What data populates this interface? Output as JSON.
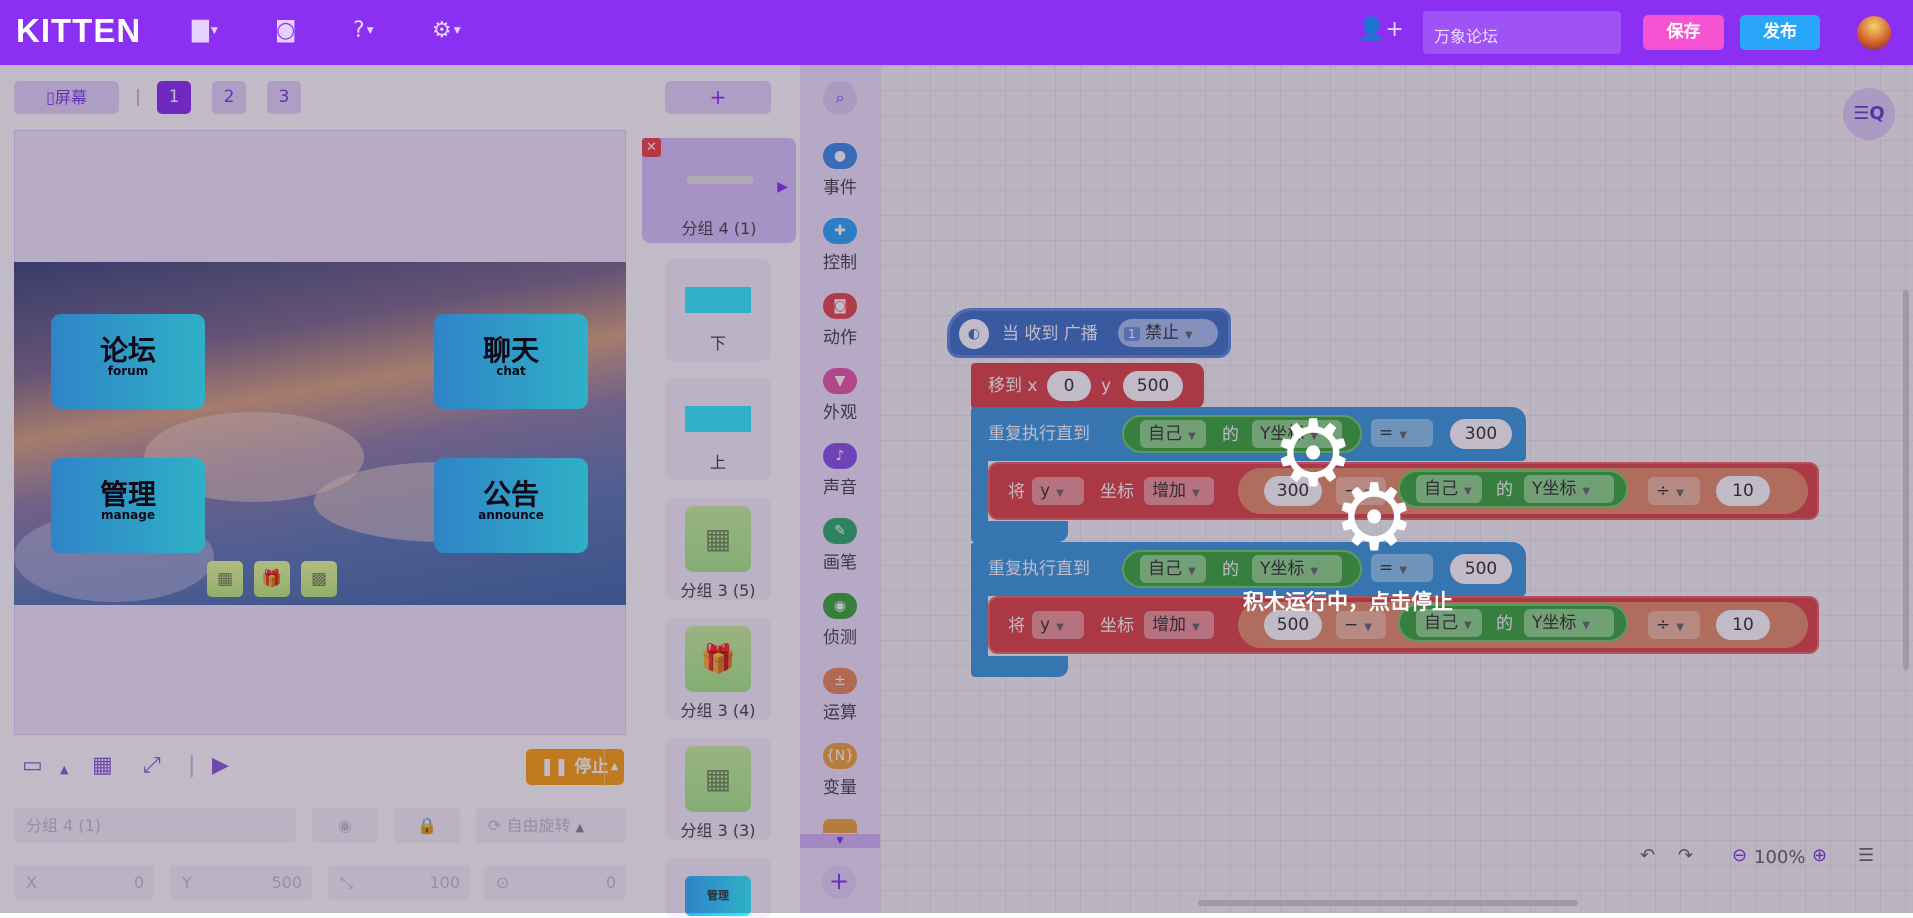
{
  "app": {
    "logo": "KITTEN",
    "search_placeholder": "万象论坛",
    "save_label": "保存",
    "publish_label": "发布"
  },
  "stage_panel": {
    "screen_label": "▯屏幕",
    "pages": [
      "1",
      "2",
      "3"
    ],
    "active_page": "1",
    "tiles": [
      {
        "cn": "论坛",
        "en": "forum"
      },
      {
        "cn": "聊天",
        "en": "chat"
      },
      {
        "cn": "管理",
        "en": "manage"
      },
      {
        "cn": "公告",
        "en": "announce"
      }
    ],
    "stop_label": "停止",
    "props": {
      "name_placeholder": "分组 4 (1)",
      "rotate_label": "自由旋转",
      "x_label": "X",
      "x_value": "0",
      "y_label": "Y",
      "y_value": "500",
      "size_value": "100",
      "rotation_value": "0"
    }
  },
  "sprite_list": {
    "add_label": "+",
    "items": [
      {
        "label": "分组 4 (1)",
        "selected": true
      },
      {
        "label": "下"
      },
      {
        "label": "上"
      },
      {
        "label": "分组 3 (5)"
      },
      {
        "label": "分组 3 (4)"
      },
      {
        "label": "分组 3 (3)"
      },
      {
        "label": "管理"
      }
    ]
  },
  "categories": [
    {
      "label": "事件",
      "color": "#3d8fe8"
    },
    {
      "label": "控制",
      "color": "#2aa6f9"
    },
    {
      "label": "动作",
      "color": "#e54a4a"
    },
    {
      "label": "外观",
      "color": "#e85aa9"
    },
    {
      "label": "声音",
      "color": "#8b52e8"
    },
    {
      "label": "画笔",
      "color": "#2fae6e"
    },
    {
      "label": "侦测",
      "color": "#39a93b"
    },
    {
      "label": "运算",
      "color": "#e88a5a"
    },
    {
      "label": "变量",
      "color": "#f0a53a"
    }
  ],
  "blocks": {
    "hat_label": "当 收到 广播",
    "hat_msg_num": "1",
    "hat_msg": "禁止",
    "move_label": "移到 x",
    "move_y_label": "y",
    "move_x": "0",
    "move_y": "500",
    "repeat_label": "重复执行直到",
    "self": "自己",
    "of": "的",
    "ycoord": "Y坐标",
    "eq": "=",
    "cond1_val": "300",
    "cond2_val": "500",
    "set_label": "将",
    "y_var": "y",
    "coord_label": "坐标",
    "inc": "增加",
    "num1": "300",
    "num2": "500",
    "minus": "−",
    "div": "÷",
    "div_val": "10"
  },
  "overlay": {
    "running_text": "积木运行中，点击停止"
  },
  "zoom": {
    "value": "100%"
  }
}
